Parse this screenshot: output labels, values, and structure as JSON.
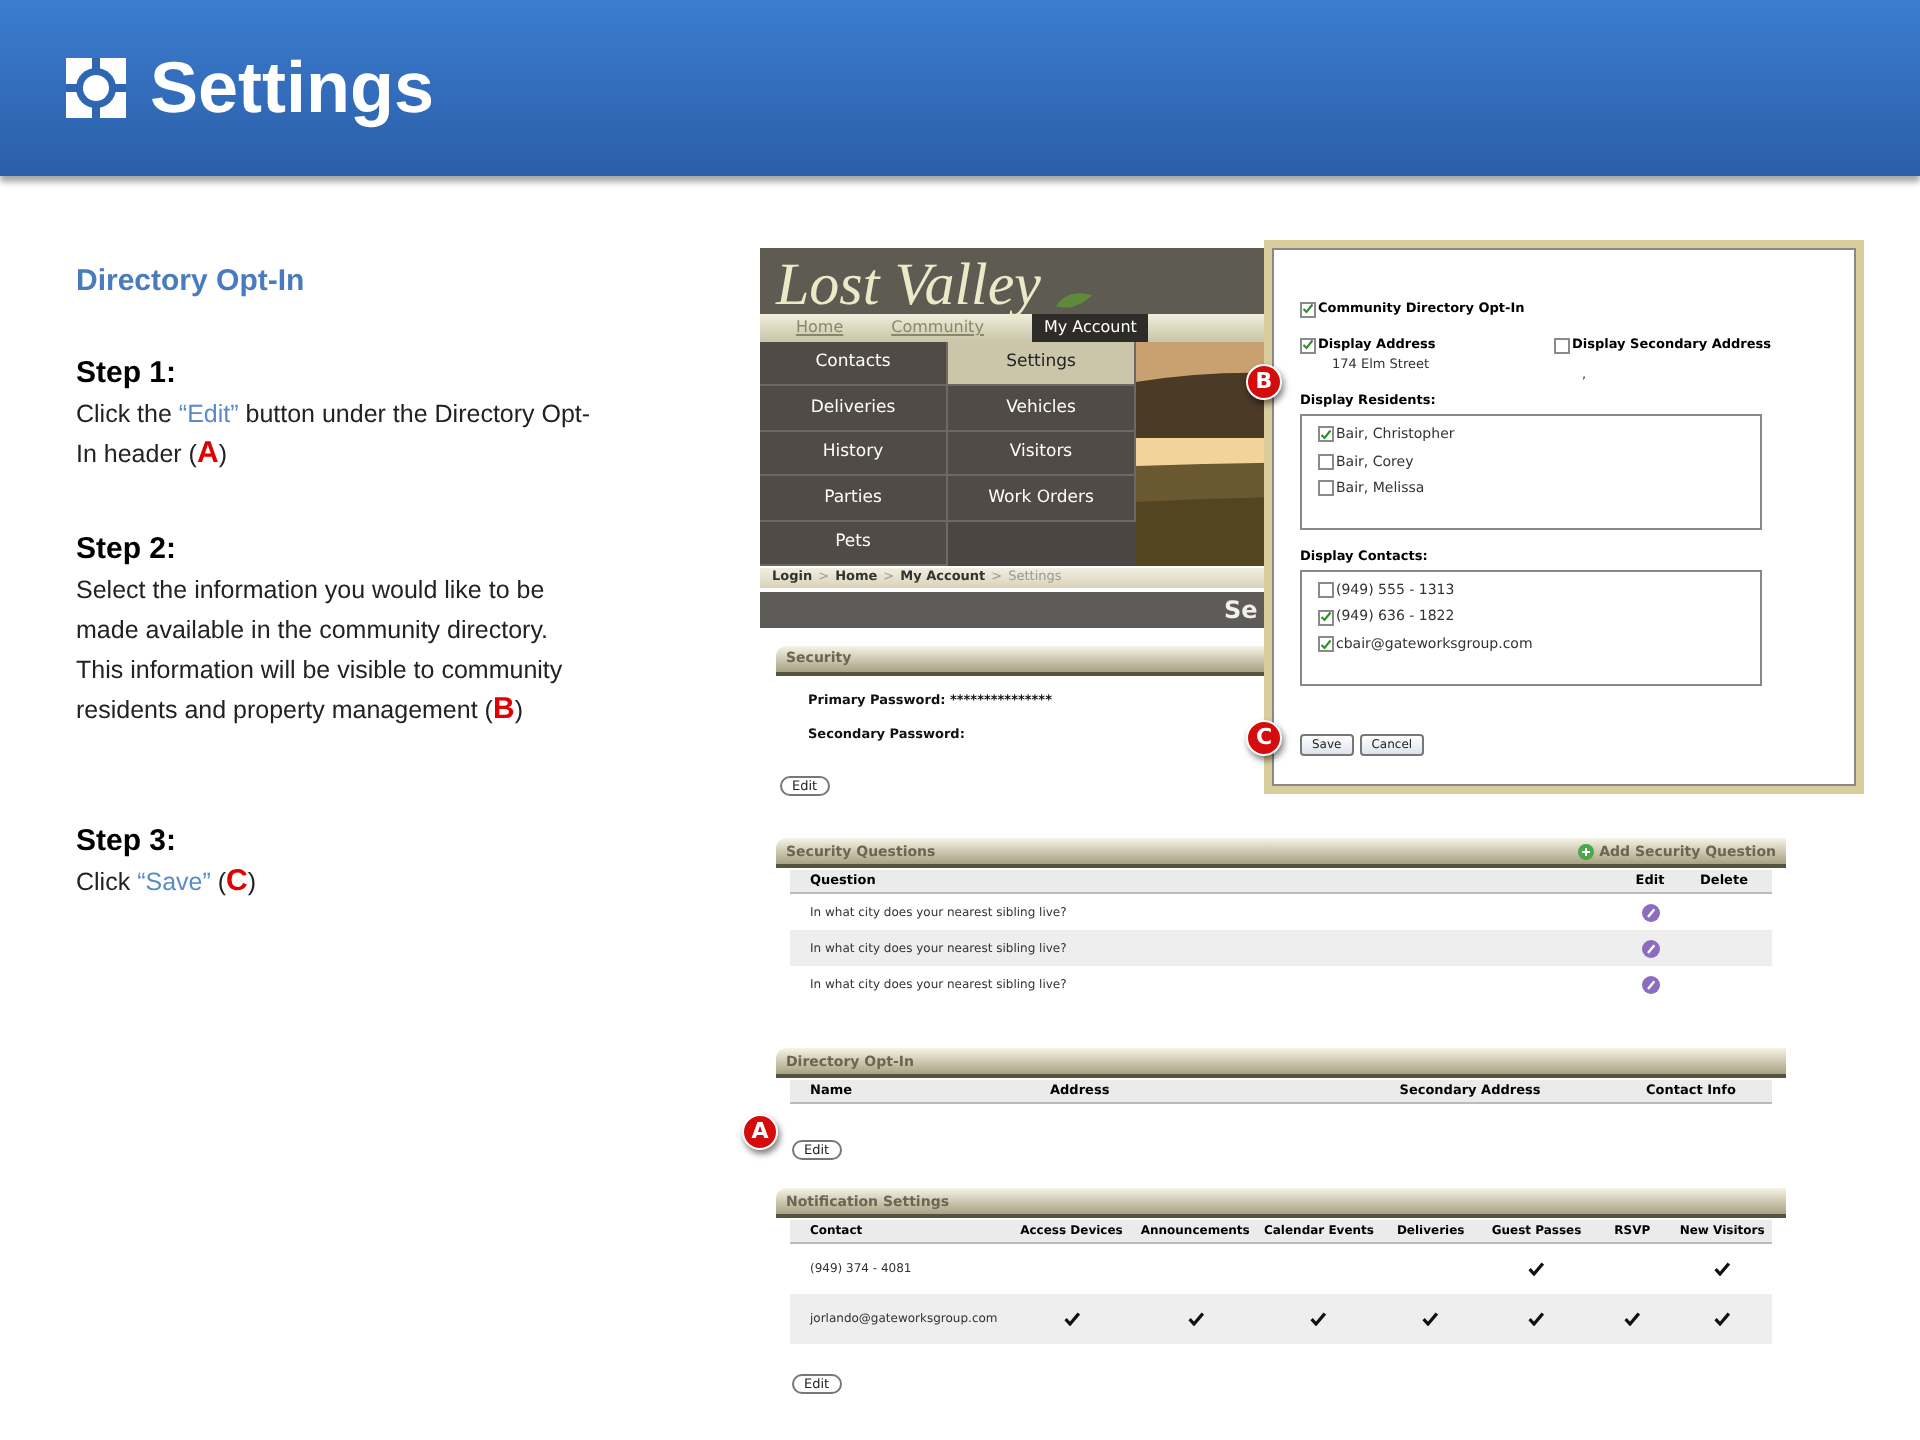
{
  "header": {
    "title": "Settings"
  },
  "section_title": "Directory Opt-In",
  "steps": [
    {
      "title": "Step 1:",
      "body": [
        {
          "kind": "plain",
          "text": "Click the "
        },
        {
          "kind": "quote",
          "text": "“Edit”"
        },
        {
          "kind": "plain",
          "text": " button under the Directory Opt-In header "
        },
        {
          "kind": "plain",
          "text": "("
        },
        {
          "kind": "marker",
          "text": "A"
        },
        {
          "kind": "plain",
          "text": ")"
        }
      ]
    },
    {
      "title": "Step 2:",
      "body": [
        {
          "kind": "plain",
          "text": "Select the information you would like to be made available in the community directory.  This information will be visible to community residents and property management "
        },
        {
          "kind": "plain",
          "text": "("
        },
        {
          "kind": "marker",
          "text": "B"
        },
        {
          "kind": "plain",
          "text": ")"
        }
      ]
    },
    {
      "title": "Step 3:",
      "body": [
        {
          "kind": "plain",
          "text": "Click "
        },
        {
          "kind": "quote",
          "text": "“Save”"
        },
        {
          "kind": "plain",
          "text": "  ("
        },
        {
          "kind": "marker",
          "text": "C"
        },
        {
          "kind": "plain",
          "text": ")"
        }
      ]
    }
  ],
  "screenshot": {
    "logo": "Lost Valley",
    "nav_tabs": [
      {
        "label": "Home",
        "selected": false
      },
      {
        "label": "Community",
        "selected": false
      },
      {
        "label": "My Account",
        "selected": true
      }
    ],
    "menu": [
      {
        "label": "Contacts",
        "selected": false
      },
      {
        "label": "Settings",
        "selected": true
      },
      {
        "label": "Deliveries",
        "selected": false
      },
      {
        "label": "Vehicles",
        "selected": false
      },
      {
        "label": "History",
        "selected": false
      },
      {
        "label": "Visitors",
        "selected": false
      },
      {
        "label": "Parties",
        "selected": false
      },
      {
        "label": "Work Orders",
        "selected": false
      },
      {
        "label": "Pets",
        "selected": false
      }
    ],
    "breadcrumb": [
      {
        "label": "Login",
        "selected": false
      },
      {
        "label": "Home",
        "selected": false
      },
      {
        "label": "My Account",
        "selected": false
      },
      {
        "label": "Settings",
        "selected": true
      }
    ],
    "breadcrumb_separator": ">",
    "page_title": "Se",
    "security": {
      "title": "Security",
      "fields": [
        {
          "label": "Primary Password:",
          "value": "***************"
        },
        {
          "label": "Secondary Password:"
        }
      ],
      "button": "Edit"
    },
    "security_questions": {
      "title": "Security Questions",
      "action": "Add Security Question",
      "columns": [
        "Question",
        "Edit",
        "Delete"
      ],
      "rows": [
        "In what city does your nearest sibling live?",
        "In what city does your nearest sibling live?",
        "In what city does your nearest sibling live?"
      ]
    },
    "directory_opt_in": {
      "title": "Directory Opt-In",
      "columns": [
        "Name",
        "Address",
        "Secondary Address",
        "Contact Info"
      ],
      "button": "Edit",
      "callout": "A"
    },
    "notification_settings": {
      "title": "Notification Settings",
      "columns": [
        "Contact",
        "Access Devices",
        "Announcements",
        "Calendar Events",
        "Deliveries",
        "Guest Passes",
        "RSVP",
        "New Visitors"
      ],
      "rows": [
        {
          "contact": "(949) 374 - 4081",
          "checks": [
            false,
            false,
            false,
            false,
            true,
            false,
            true
          ]
        },
        {
          "contact": "jorlando@gateworksgroup.com",
          "checks": [
            true,
            true,
            true,
            true,
            true,
            true,
            true
          ]
        }
      ],
      "button": "Edit"
    },
    "popup": {
      "opt_in": {
        "label": "Community Directory Opt-In",
        "checked": true
      },
      "display_address": {
        "label": "Display Address",
        "checked": true,
        "value": "174 Elm Street"
      },
      "display_secondary": {
        "label": "Display Secondary Address",
        "checked": false,
        "value": ","
      },
      "residents": {
        "label": "Display Residents:",
        "callout": "B",
        "items": [
          {
            "label": "Bair, Christopher",
            "checked": true
          },
          {
            "label": "Bair, Corey",
            "checked": false
          },
          {
            "label": "Bair, Melissa",
            "checked": false
          }
        ]
      },
      "contacts": {
        "label": "Display Contacts:",
        "items": [
          {
            "label": "(949) 555 - 1313",
            "checked": false
          },
          {
            "label": "(949) 636 - 1822",
            "checked": true
          },
          {
            "label": "cbair@gateworksgroup.com",
            "checked": true
          }
        ]
      },
      "buttons": [
        "Save",
        "Cancel"
      ],
      "buttons_callout": "C"
    }
  }
}
